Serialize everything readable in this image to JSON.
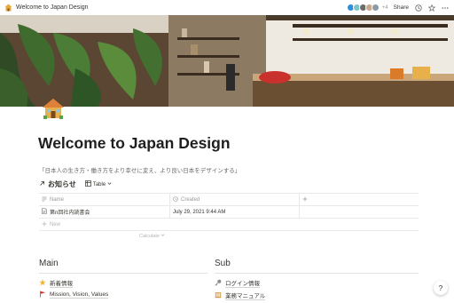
{
  "window": {
    "title": "Welcome to Japan Design"
  },
  "topbar": {
    "avatar_extra_count": "+4",
    "share_label": "Share",
    "icons": [
      "clock-icon",
      "star-icon",
      "more-icon"
    ]
  },
  "page": {
    "icon": "house-icon",
    "title": "Welcome to Japan Design",
    "tagline": "「日本人の生き方・働き方をより幸せに変え、より良い日本をデザインする」"
  },
  "database": {
    "title": "お知らせ",
    "view_label": "Table",
    "columns": [
      {
        "label": "Name",
        "icon": "text-icon"
      },
      {
        "label": "Created",
        "icon": "clock-icon"
      }
    ],
    "rows": [
      {
        "name": "第n回社内読書会",
        "created": "July 29, 2021 9:44 AM"
      }
    ],
    "new_label": "New",
    "calculate_label": "Calculate"
  },
  "sections": {
    "main": {
      "heading": "Main",
      "links": [
        {
          "icon": "star-icon",
          "label": "新着情報"
        },
        {
          "icon": "flag-icon",
          "label": "Mission, Vision, Values"
        }
      ]
    },
    "sub": {
      "heading": "Sub",
      "links": [
        {
          "icon": "key-icon",
          "label": "ログイン情報"
        },
        {
          "icon": "book-icon",
          "label": "業務マニュアル"
        }
      ]
    }
  },
  "help_label": "?",
  "colors": {
    "text": "#37352f",
    "muted": "#9b9a97",
    "divider": "#e9e9e7",
    "avatar_accent": "#2e8fd8"
  }
}
